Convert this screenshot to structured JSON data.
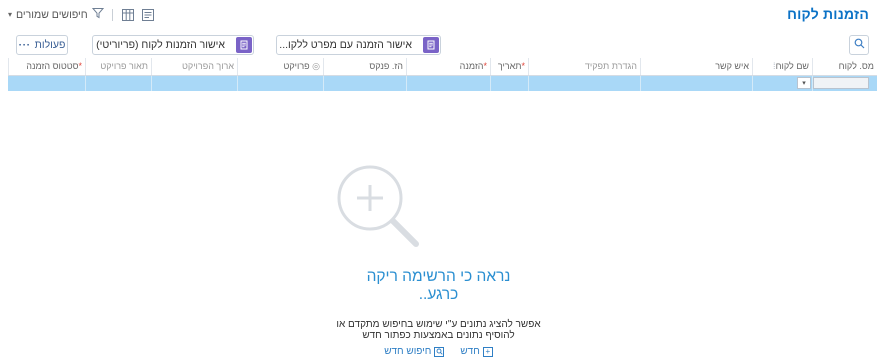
{
  "header": {
    "title": "הזמנות לקוח",
    "saved_searches_label": "חיפושים שמורים",
    "icons": [
      "filter-icon",
      "grid-view-icon",
      "report-icon"
    ]
  },
  "toolbar": {
    "search_icon": "search-icon",
    "approve_by_details_label": "אישור הזמנה עם מפרט ללקו...",
    "approve_by_priority_label": "אישור הזמנות לקוח (פריוריטי)",
    "actions_label": "פעולות",
    "actions_icon": "ellipsis"
  },
  "table": {
    "columns": [
      {
        "label": "מס. לקוח",
        "required": false,
        "dimmed": false
      },
      {
        "label": "שם לקוח",
        "required": false,
        "dimmed": false
      },
      {
        "label": "איש קשר",
        "required": false,
        "dimmed": false
      },
      {
        "label": "הגדרת תפקיד",
        "required": false,
        "dimmed": true
      },
      {
        "label": "תאריך",
        "required": true,
        "dimmed": false
      },
      {
        "label": "הזמנה",
        "required": true,
        "dimmed": false
      },
      {
        "label": "הז. פנקס",
        "required": false,
        "dimmed": false
      },
      {
        "label": "פרויקט",
        "required": false,
        "dimmed": false
      },
      {
        "label": "ארוך הפרויקט",
        "required": false,
        "dimmed": true
      },
      {
        "label": "תאור פרויקט",
        "required": false,
        "dimmed": true
      },
      {
        "label": "סטטוס הזמנה",
        "required": true,
        "dimmed": false
      }
    ]
  },
  "empty_state": {
    "title_line1": "נראה כי הרשימה ריקה",
    "title_line2": "כרגע..",
    "subtitle_line1": "אפשר להציג נתונים ע\"י שימוש בחיפוש מתקדם או",
    "subtitle_line2": "להוסיף נתונים באמצעות כפתור חדש",
    "new_label": "חדש",
    "new_search_label": "חיפוש חדש"
  },
  "colors": {
    "accent": "#0b72c6",
    "selected_row": "#a9d8f7",
    "badge_purple": "#7a63c7",
    "required": "#e0453a"
  }
}
